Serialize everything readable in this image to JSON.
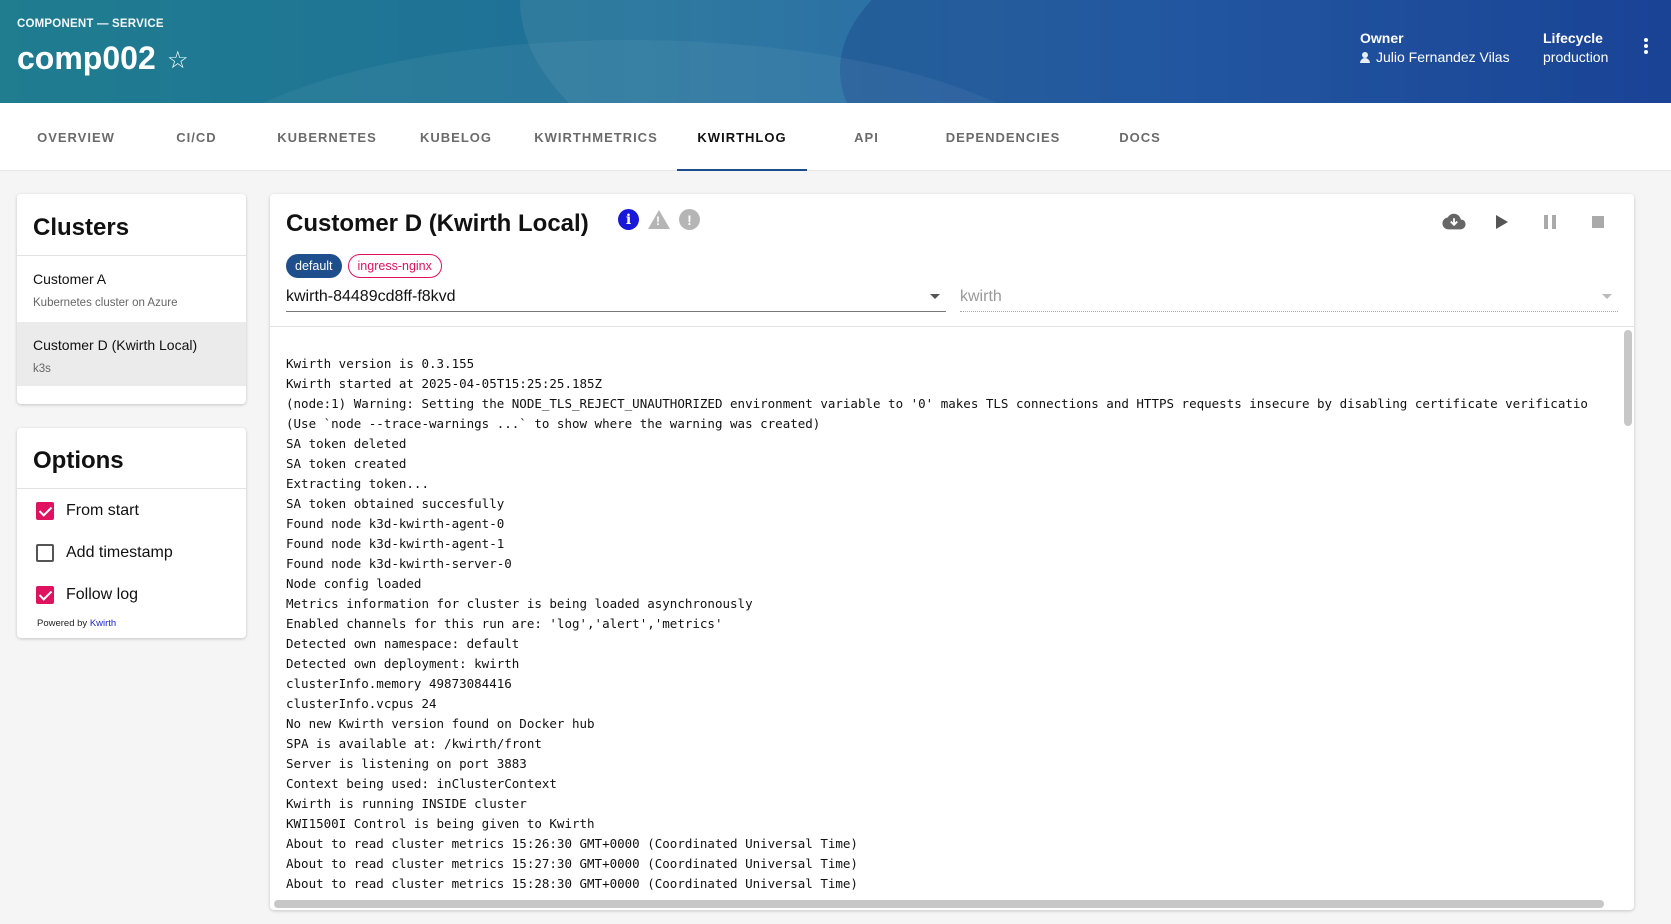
{
  "header": {
    "kind": "COMPONENT — SERVICE",
    "title": "comp002",
    "owner_label": "Owner",
    "owner": "Julio Fernandez Vilas",
    "lifecycle_label": "Lifecycle",
    "lifecycle": "production",
    "star_icon": "star-outline-icon",
    "menu_icon": "kebab-menu-icon"
  },
  "tabs": [
    {
      "label": "OVERVIEW"
    },
    {
      "label": "CI/CD"
    },
    {
      "label": "KUBERNETES"
    },
    {
      "label": "KUBELOG"
    },
    {
      "label": "KWIRTHMETRICS"
    },
    {
      "label": "KWIRTHLOG",
      "active": true
    },
    {
      "label": "API"
    },
    {
      "label": "DEPENDENCIES"
    },
    {
      "label": "DOCS"
    }
  ],
  "clusters": {
    "title": "Clusters",
    "items": [
      {
        "name": "Customer A",
        "description": "Kubernetes cluster on Azure",
        "selected": false
      },
      {
        "name": "Customer D (Kwirth Local)",
        "description": "k3s",
        "selected": true
      }
    ]
  },
  "options": {
    "title": "Options",
    "items": [
      {
        "label": "From start",
        "checked": true
      },
      {
        "label": "Add timestamp",
        "checked": false
      },
      {
        "label": "Follow log",
        "checked": true
      }
    ],
    "powered_prefix": "Powered by",
    "powered_link": "Kwirth"
  },
  "main": {
    "title": "Customer D (Kwirth Local)",
    "status_icons": [
      "info-icon",
      "warning-icon",
      "error-icon"
    ],
    "actions": [
      "download-icon",
      "play-icon",
      "pause-icon",
      "stop-icon"
    ],
    "namespaces": [
      {
        "label": "default",
        "selected": true
      },
      {
        "label": "ingress-nginx",
        "selected": false
      }
    ],
    "pod_select": "kwirth-84489cd8ff-f8kvd",
    "container_select": "kwirth",
    "log_lines": [
      "Kwirth version is 0.3.155",
      "Kwirth started at 2025-04-05T15:25:25.185Z",
      "(node:1) Warning: Setting the NODE_TLS_REJECT_UNAUTHORIZED environment variable to '0' makes TLS connections and HTTPS requests insecure by disabling certificate verificatio",
      "(Use `node --trace-warnings ...` to show where the warning was created)",
      "SA token deleted",
      "SA token created",
      "Extracting token...",
      "SA token obtained succesfully",
      "Found node k3d-kwirth-agent-0",
      "Found node k3d-kwirth-agent-1",
      "Found node k3d-kwirth-server-0",
      "Node config loaded",
      "Metrics information for cluster is being loaded asynchronously",
      "Enabled channels for this run are: 'log','alert','metrics'",
      "Detected own namespace: default",
      "Detected own deployment: kwirth",
      "clusterInfo.memory 49873084416",
      "clusterInfo.vcpus 24",
      "No new Kwirth version found on Docker hub",
      "SPA is available at: /kwirth/front",
      "Server is listening on port 3883",
      "Context being used: inClusterContext",
      "Kwirth is running INSIDE cluster",
      "KWI1500I Control is being given to Kwirth",
      "About to read cluster metrics 15:26:30 GMT+0000 (Coordinated Universal Time)",
      "About to read cluster metrics 15:27:30 GMT+0000 (Coordinated Universal Time)",
      "About to read cluster metrics 15:28:30 GMT+0000 (Coordinated Universal Time)"
    ]
  },
  "colors": {
    "accent": "#e0115f",
    "primary": "#1e4f8c",
    "info": "#1818d9"
  }
}
